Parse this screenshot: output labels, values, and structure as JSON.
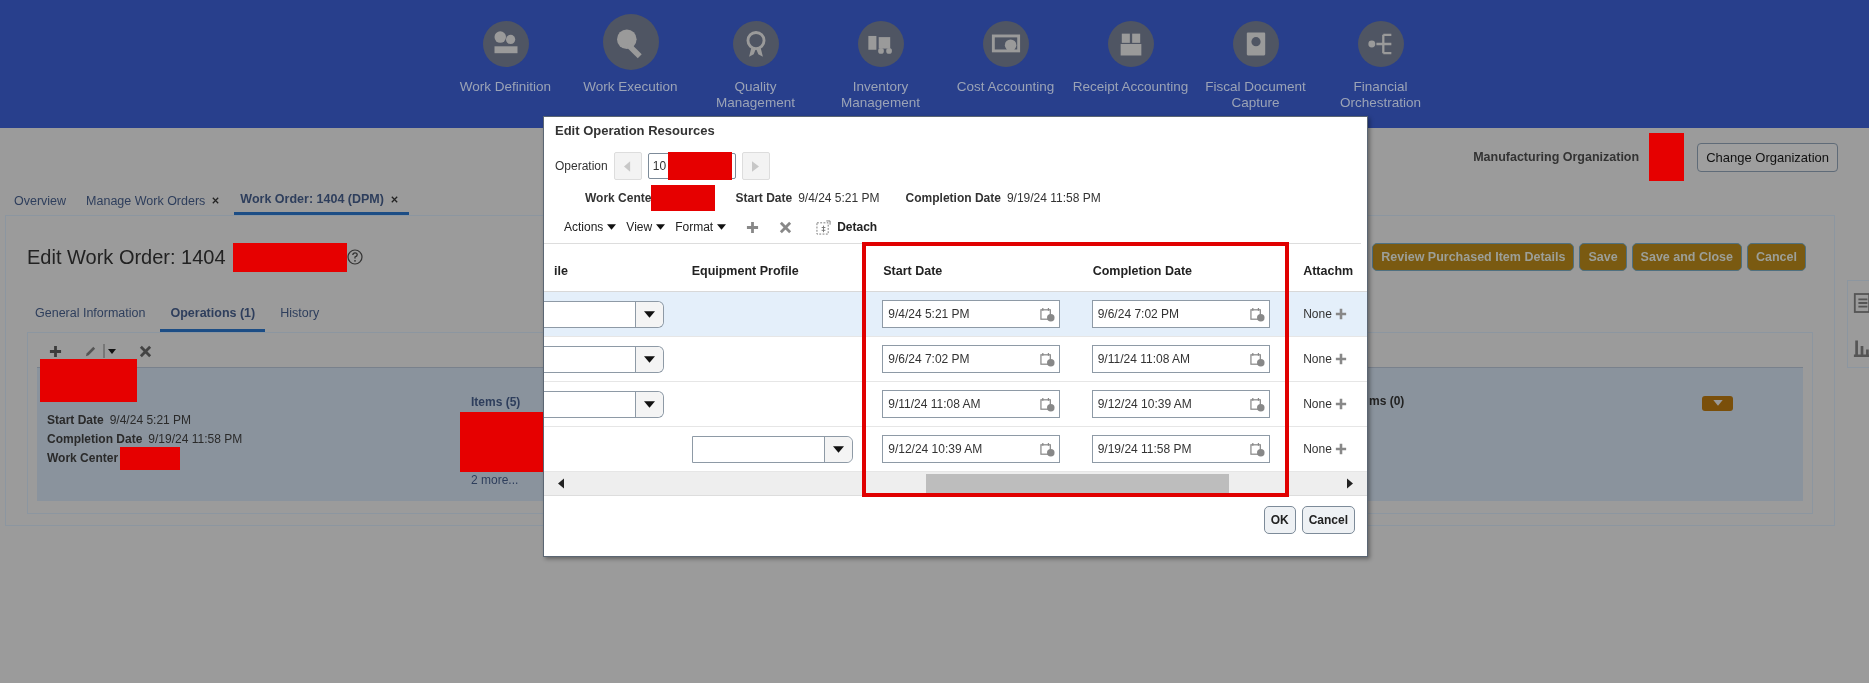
{
  "nav": [
    {
      "label": "Work Definition",
      "kind": "gears",
      "selected": false
    },
    {
      "label": "Work Execution",
      "kind": "tools",
      "selected": true
    },
    {
      "label": "Quality Management",
      "kind": "award",
      "selected": false
    },
    {
      "label": "Inventory Management",
      "kind": "forklift",
      "selected": false
    },
    {
      "label": "Cost Accounting",
      "kind": "money",
      "selected": false
    },
    {
      "label": "Receipt Accounting",
      "kind": "boxes",
      "selected": false
    },
    {
      "label": "Fiscal Document Capture",
      "kind": "certificate",
      "selected": false
    },
    {
      "label": "Financial Orchestration",
      "kind": "flow",
      "selected": false
    }
  ],
  "organization": {
    "label": "Manufacturing Organization",
    "button": "Change Organization"
  },
  "tabs": [
    {
      "label": "Overview",
      "closable": false,
      "selected": false
    },
    {
      "label": "Manage Work Orders",
      "closable": true,
      "selected": false
    },
    {
      "label": "Work Order: 1404 (DPM)",
      "closable": true,
      "selected": true
    }
  ],
  "page": {
    "title": "Edit Work Order: 1404",
    "buttons": [
      "Review Purchased Item Details",
      "Save",
      "Save and Close",
      "Cancel"
    ]
  },
  "subtabs": [
    {
      "label": "General Information",
      "selected": false
    },
    {
      "label": "Operations (1)",
      "selected": true
    },
    {
      "label": "History",
      "selected": false
    }
  ],
  "operation_card": {
    "fields": [
      {
        "label": "Start Date",
        "value": "9/4/24 5:21 PM"
      },
      {
        "label": "Completion Date",
        "value": "9/19/24 11:58 PM"
      },
      {
        "label": "Work Center"
      }
    ],
    "items_label": "Items (5)",
    "more_link": "2 more...",
    "other_label": "ms (0)"
  },
  "dialog": {
    "title": "Edit Operation Resources",
    "operation": {
      "label": "Operation",
      "value": "10"
    },
    "info": [
      {
        "label": "Work Cente"
      },
      {
        "label": "Start Date",
        "value": "9/4/24 5:21 PM"
      },
      {
        "label": "Completion Date",
        "value": "9/19/24 11:58 PM"
      }
    ],
    "menus": [
      "Actions",
      "View",
      "Format"
    ],
    "detach": "Detach",
    "columns": [
      "ile",
      "Equipment Profile",
      "Start Date",
      "Completion Date",
      "Attachm"
    ],
    "rows": [
      {
        "selected": true,
        "resource_dropdown": true,
        "equipment_dropdown": false,
        "start": "9/4/24 5:21 PM",
        "completion": "9/6/24 7:02 PM",
        "attachments": "None"
      },
      {
        "selected": false,
        "resource_dropdown": true,
        "equipment_dropdown": false,
        "start": "9/6/24 7:02 PM",
        "completion": "9/11/24 11:08 AM",
        "attachments": "None"
      },
      {
        "selected": false,
        "resource_dropdown": true,
        "equipment_dropdown": false,
        "start": "9/11/24 11:08 AM",
        "completion": "9/12/24 10:39 AM",
        "attachments": "None"
      },
      {
        "selected": false,
        "resource_dropdown": false,
        "equipment_dropdown": true,
        "start": "9/12/24 10:39 AM",
        "completion": "9/19/24 11:58 PM",
        "attachments": "None"
      }
    ],
    "buttons": [
      "OK",
      "Cancel"
    ]
  }
}
